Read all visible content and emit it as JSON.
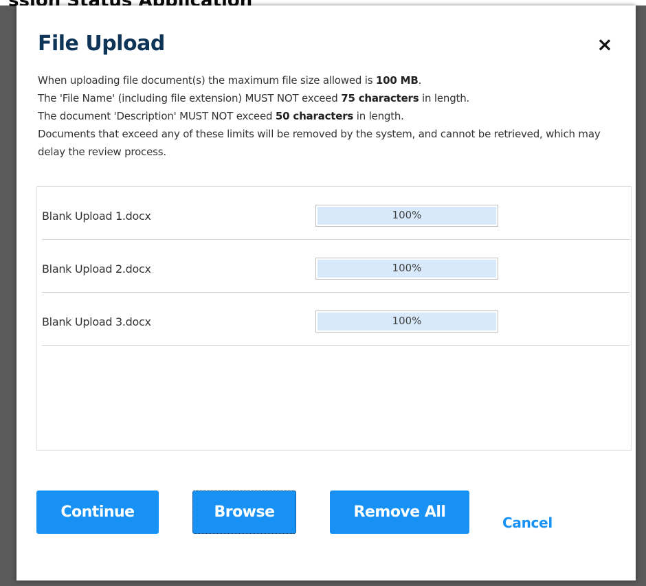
{
  "background": {
    "page_title": "ssion Status Application"
  },
  "modal": {
    "title": "File Upload",
    "close_symbol": "×",
    "instructions": {
      "line1_pre": "When uploading file document(s) the maximum file size allowed is ",
      "line1_bold": "100 MB",
      "line1_post": ".",
      "line2_pre": "The 'File Name' (including file extension) MUST NOT exceed ",
      "line2_bold": "75 characters",
      "line2_post": " in length.",
      "line3_pre": "The document 'Description' MUST NOT exceed ",
      "line3_bold": "50 characters",
      "line3_post": " in length.",
      "line4": "Documents that exceed any of these limits will be removed by the system, and cannot be retrieved, which may delay the review process."
    },
    "files": [
      {
        "name": "Blank Upload 1.docx",
        "progress_label": "100%",
        "progress": 1.0
      },
      {
        "name": "Blank Upload 2.docx",
        "progress_label": "100%",
        "progress": 1.0
      },
      {
        "name": "Blank Upload 3.docx",
        "progress_label": "100%",
        "progress": 1.0
      }
    ],
    "buttons": {
      "continue": "Continue",
      "browse": "Browse",
      "remove_all": "Remove All",
      "cancel": "Cancel"
    }
  },
  "colors": {
    "title": "#0e3458",
    "primary_button": "#1891f4",
    "progress_fill": "#d7e9fa",
    "overlay": "#5a5a5a"
  },
  "icons": {
    "close": "close-icon"
  }
}
